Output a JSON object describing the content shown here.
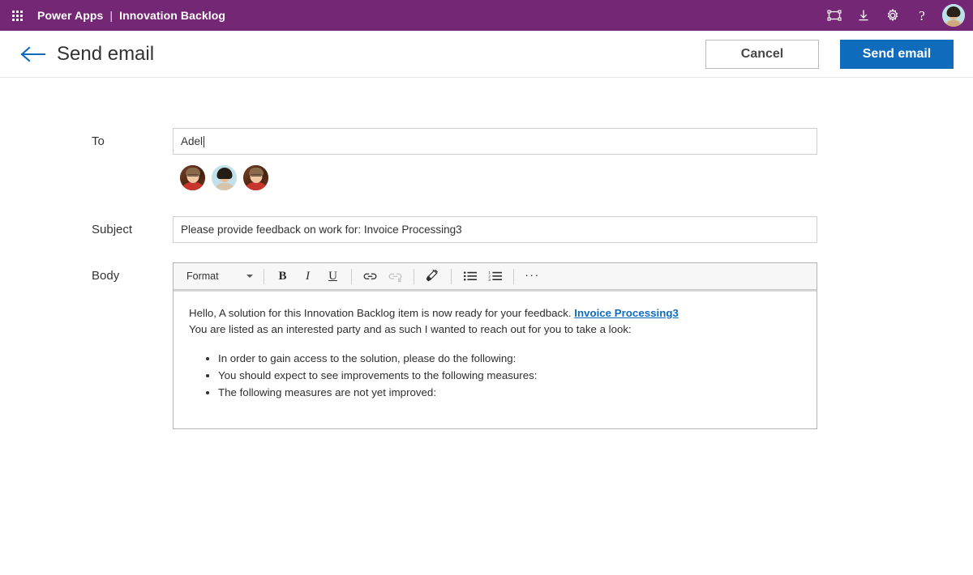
{
  "suite": {
    "waffle_icon": "app-launcher-waffle-icon",
    "brand": "Power Apps",
    "separator": "|",
    "app_name": "Innovation Backlog",
    "actions": [
      {
        "icon": "resize-fullscreen-icon",
        "label": "Fit to screen"
      },
      {
        "icon": "download-icon",
        "label": "Download"
      },
      {
        "icon": "gear-icon",
        "label": "Settings"
      },
      {
        "icon": "help-question-icon",
        "label": "?"
      }
    ],
    "avatar": "user-avatar"
  },
  "header": {
    "back_icon": "back-arrow-icon",
    "title": "Send email",
    "cancel_label": "Cancel",
    "send_label": "Send email"
  },
  "form": {
    "to": {
      "label": "To",
      "value": "Adel",
      "placeholder": ""
    },
    "suggestions": [
      {
        "name": "contact-avatar-1"
      },
      {
        "name": "contact-avatar-2"
      },
      {
        "name": "contact-avatar-3"
      }
    ],
    "subject": {
      "label": "Subject",
      "value": "Please provide feedback on work for: Invoice Processing3",
      "placeholder": ""
    },
    "body": {
      "label": "Body"
    }
  },
  "toolbar": {
    "format_label": "Format",
    "buttons": [
      {
        "name": "bold-button",
        "glyph": "B"
      },
      {
        "name": "italic-button",
        "glyph": "I"
      },
      {
        "name": "underline-button",
        "glyph": "U"
      },
      {
        "name": "link-button",
        "glyph": "link-icon"
      },
      {
        "name": "unlink-button",
        "glyph": "unlink-icon",
        "disabled": true
      },
      {
        "name": "highlight-button",
        "glyph": "highlighter-icon"
      },
      {
        "name": "bulleted-list-button",
        "glyph": "bulleted-list-icon"
      },
      {
        "name": "numbered-list-button",
        "glyph": "numbered-list-icon"
      },
      {
        "name": "more-options-button",
        "glyph": "ellipsis-icon"
      }
    ],
    "bold_glyph": "B",
    "italic_glyph": "I",
    "underline_glyph": "U",
    "ellipsis_glyph": "···"
  },
  "email_body": {
    "line1_prefix": "Hello, A solution for this Innovation Backlog item is now ready for your feedback. ",
    "line1_link": "Invoice Processing3",
    "line2": "You are listed as an interested party and as such I wanted to reach out for you to take a look:",
    "bullets": [
      "In order to gain access to the solution, please do the following:",
      "You should expect to see improvements to the following measures:",
      "The following measures are not yet improved:"
    ]
  },
  "colors": {
    "suite_purple": "#742774",
    "primary_blue": "#0f6cbd",
    "link_blue": "#0f6cbd",
    "back_arrow_blue": "#0f6cbd"
  }
}
